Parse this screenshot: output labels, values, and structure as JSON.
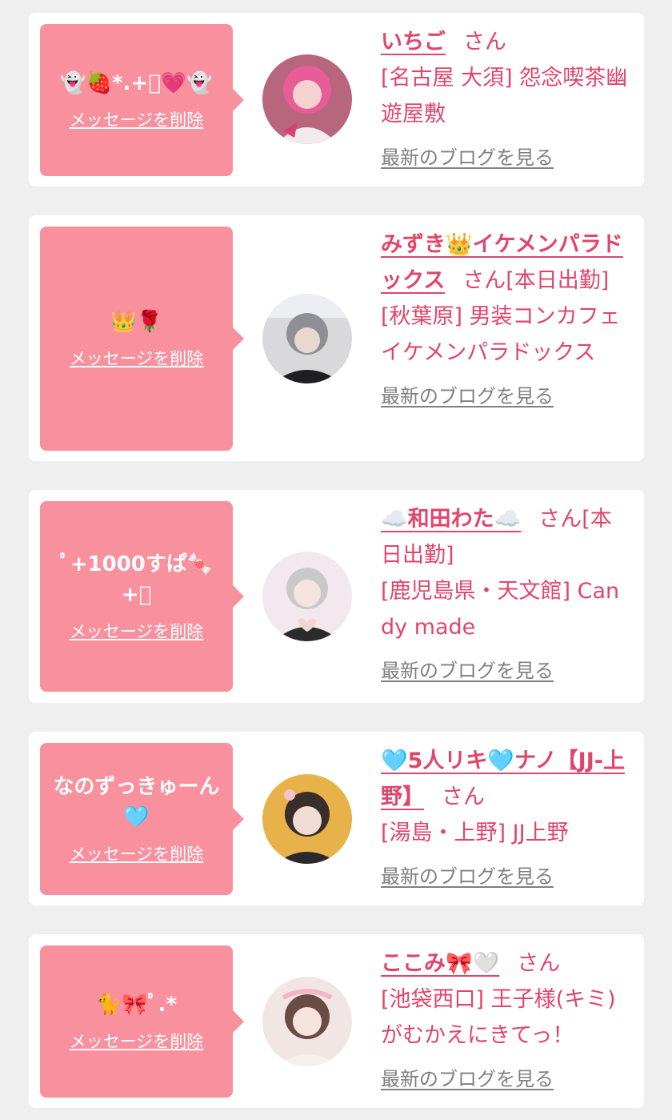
{
  "delete_label": "メッセージを削除",
  "blog_label": "最新のブログを見る",
  "colors": {
    "background": "#efefef",
    "card": "#ffffff",
    "bubble": "#f8909e",
    "accent_text": "#e0456b",
    "link_gray": "#808080"
  },
  "cards": [
    {
      "message": "👻🍓*.+ﾟ💗👻",
      "name": "いちご",
      "san": "さん",
      "shop": "[名古屋 大須] 怨念喫茶幽遊屋敷"
    },
    {
      "message": "👑🌹",
      "name": "みずき👑イケメンパラドックス",
      "san": "さん[本日出勤]",
      "shop": "[秋葉原] 男装コンカフェイケメンパラドックス"
    },
    {
      "message": "ﾟ+1000すぱ🍬+ﾟ",
      "name": "☁️和田わた☁️",
      "san": "さん[本日出勤]",
      "shop": "[鹿児島県・天文館] Candy made"
    },
    {
      "message": "なのずっきゅーん🩵",
      "name": "🩵5人リキ🩵ナノ【JJ-上野】",
      "san": "さん",
      "shop": "[湯島・上野] JJ上野"
    },
    {
      "message": "🐈🎀ﾟ.*",
      "name": "ここみ🎀🤍",
      "san": "さん",
      "shop": "[池袋西口] 王子様(キミ)がむかえにきてっ！"
    }
  ]
}
